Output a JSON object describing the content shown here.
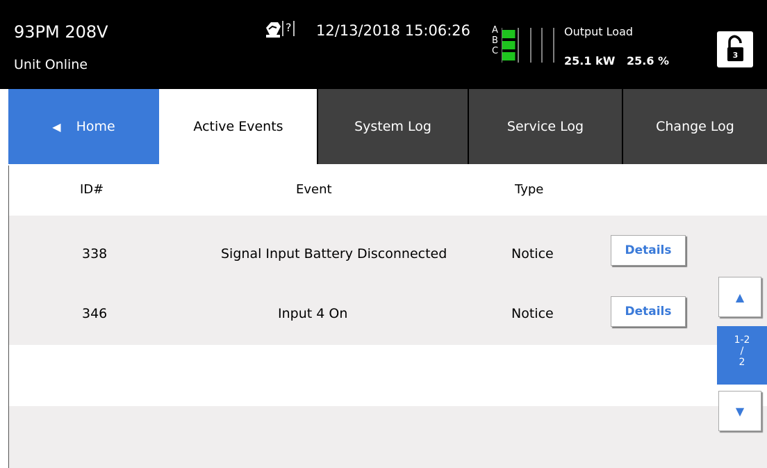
{
  "header": {
    "model": "93PM 208V",
    "status": "Unit Online",
    "datetime": "12/13/2018 15:06:26",
    "phases": [
      "A",
      "B",
      "C"
    ],
    "phase_levels": [
      0.25,
      0.25,
      0.25
    ],
    "output_load_label": "Output Load",
    "output_kw": "25.1 kW",
    "output_pct": "25.6 %",
    "lock_number": "3",
    "help_icon": "help-question-icon",
    "lock_icon": "unlock-icon"
  },
  "tabs": {
    "home": "Home",
    "active_events": "Active Events",
    "system_log": "System Log",
    "service_log": "Service Log",
    "change_log": "Change Log"
  },
  "table": {
    "columns": [
      "ID#",
      "Event",
      "Type"
    ],
    "rows": [
      {
        "id": "338",
        "event": "Signal Input Battery Disconnected",
        "type": "Notice",
        "action": "Details"
      },
      {
        "id": "346",
        "event": "Input 4 On",
        "type": "Notice",
        "action": "Details"
      }
    ]
  },
  "pager": {
    "range": "1-2",
    "slash": "/",
    "total": "2"
  },
  "colors": {
    "accent": "#3a7ad9",
    "meter": "#1ec41e",
    "tab_dark": "#404040"
  }
}
